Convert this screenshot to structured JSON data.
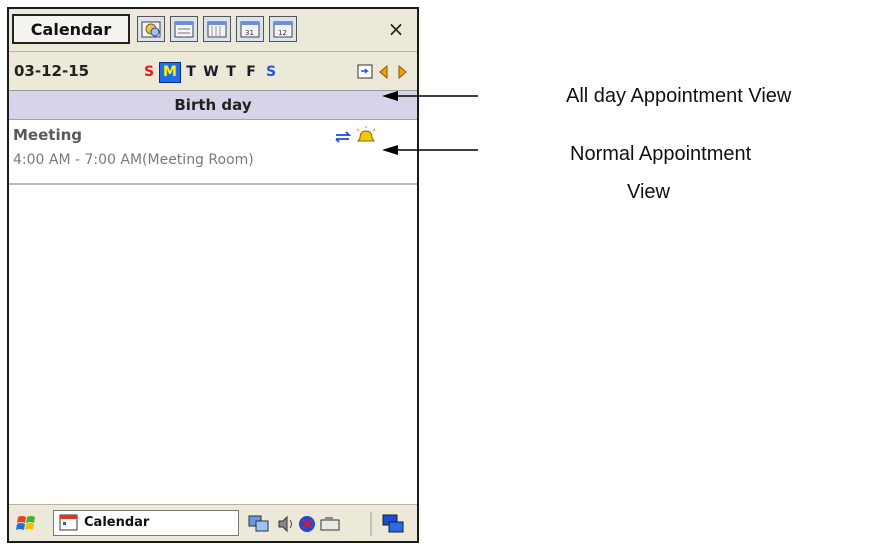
{
  "toolbar": {
    "app_title": "Calendar",
    "view_icons": [
      "agenda-view-icon",
      "day-view-icon",
      "week-view-icon",
      "month-view-icon",
      "year-view-icon"
    ],
    "close_label": "×"
  },
  "date_bar": {
    "date": "03-12-15",
    "days": [
      {
        "label": "S",
        "color": "#e8161a"
      },
      {
        "label": "M",
        "color": "#fff200",
        "selected": true
      },
      {
        "label": "T",
        "color": "#1a1a2e"
      },
      {
        "label": "W",
        "color": "#1a1a2e"
      },
      {
        "label": "T",
        "color": "#1a1a2e"
      },
      {
        "label": "F",
        "color": "#1a1a2e"
      },
      {
        "label": "S",
        "color": "#1e5bd8"
      }
    ]
  },
  "all_day": {
    "title": "Birth day"
  },
  "appointment": {
    "title": "Meeting",
    "time": "4:00 AM - 7:00 AM(Meeting Room)"
  },
  "taskbar": {
    "app_label": "Calendar"
  },
  "annotations": {
    "all_day_view": "All day Appointment View",
    "normal_view_line1": "Normal Appointment",
    "normal_view_line2": "View"
  }
}
